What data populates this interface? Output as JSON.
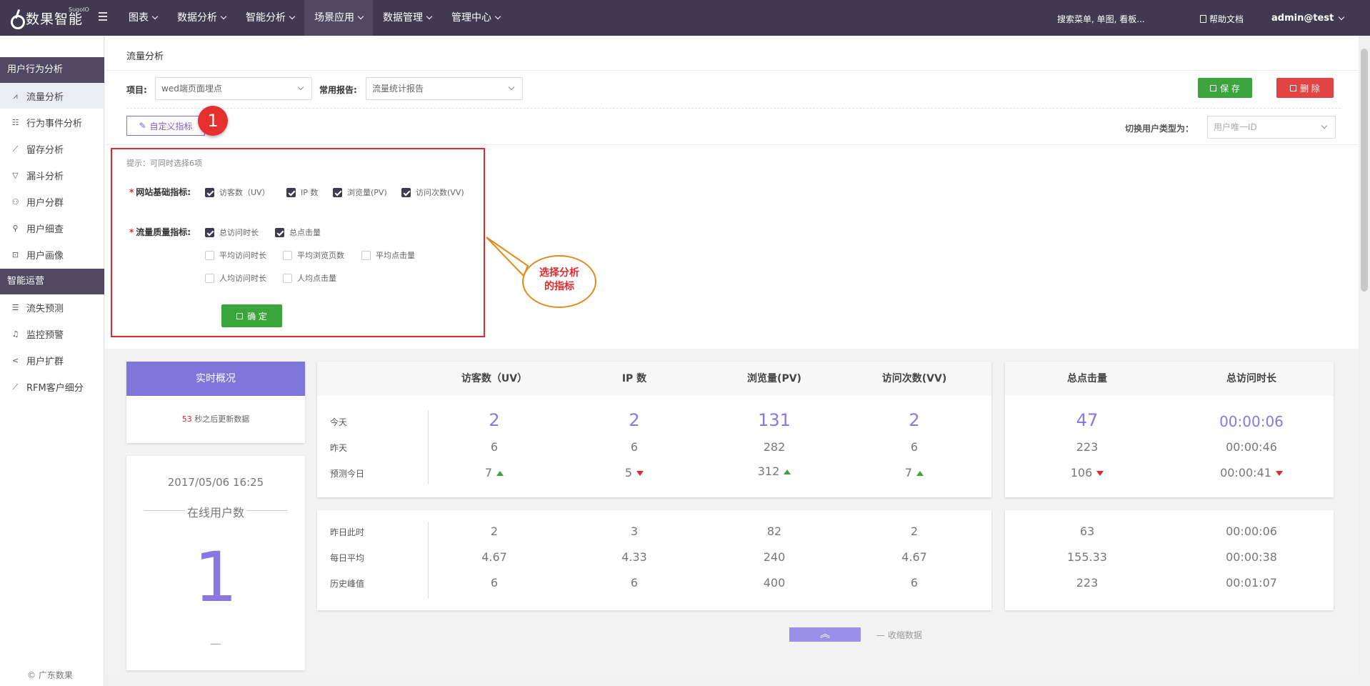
{
  "topbar": {
    "logo_text": "数果智能",
    "logo_sub": "SugoIO",
    "nav": [
      "图表",
      "数据分析",
      "智能分析",
      "场景应用",
      "数据管理",
      "管理中心"
    ],
    "search_text": "搜索菜单, 单图, 看板...",
    "help_text": "帮助文档",
    "user": "admin@test"
  },
  "sidebar": {
    "group1": "用户行为分析",
    "items1": [
      "流量分析",
      "行为事件分析",
      "留存分析",
      "漏斗分析",
      "用户分群",
      "用户细查",
      "用户画像"
    ],
    "group2": "智能运营",
    "items2": [
      "流失预测",
      "监控预警",
      "用户扩群",
      "RFM客户细分"
    ],
    "copyright": "© 广东数果"
  },
  "page": {
    "title": "流量分析",
    "project_label": "项目:",
    "project_value": "wed端页面埋点",
    "report_label": "常用报告:",
    "report_value": "流量统计报告",
    "save": "保 存",
    "delete": "删 除",
    "custom_metric": "自定义指标",
    "badge": "1",
    "switch_label": "切换用户类型为：",
    "switch_placeholder": "用户唯一ID"
  },
  "selector": {
    "hint": "提示：可同时选择6项",
    "basic_label": "网站基础指标:",
    "basic": [
      {
        "label": "访客数（UV）",
        "checked": true
      },
      {
        "label": "IP 数",
        "checked": true
      },
      {
        "label": "浏览量(PV)",
        "checked": true
      },
      {
        "label": "访问次数(VV)",
        "checked": true
      }
    ],
    "quality_label": "流量质量指标:",
    "quality": [
      {
        "label": "总访问时长",
        "checked": true
      },
      {
        "label": "总点击量",
        "checked": true
      },
      {
        "label": "平均访问时长",
        "checked": false
      },
      {
        "label": "平均浏览页数",
        "checked": false
      },
      {
        "label": "平均点击量",
        "checked": false
      },
      {
        "label": "人均访问时长",
        "checked": false
      },
      {
        "label": "人均点击量",
        "checked": false
      }
    ],
    "confirm": "确 定",
    "callout": "选择分析\n的指标"
  },
  "realtime": {
    "title": "实时概况",
    "countdown": "53",
    "countdown_suffix": "秒之后更新数据",
    "datetime": "2017/05/06 16:25",
    "online_label": "在线用户数",
    "online_count": "1",
    "dash": "—"
  },
  "table1": {
    "headers": [
      "访客数（UV）",
      "IP 数",
      "浏览量(PV)",
      "访问次数(VV)"
    ],
    "row_labels": [
      "今天",
      "昨天",
      "预测今日"
    ],
    "today": [
      "2",
      "2",
      "131",
      "2"
    ],
    "yesterday": [
      "6",
      "6",
      "282",
      "6"
    ],
    "forecast": [
      "7",
      "5",
      "312",
      "7"
    ],
    "forecast_trend": [
      "up",
      "down",
      "up",
      "up"
    ]
  },
  "table2": {
    "headers": [
      "总点击量",
      "总访问时长"
    ],
    "today": [
      "47",
      "00:00:06"
    ],
    "yesterday": [
      "223",
      "00:00:46"
    ],
    "forecast": [
      "106",
      "00:00:41"
    ],
    "forecast_trend": [
      "down",
      "down"
    ]
  },
  "table3": {
    "row_labels": [
      "昨日此时",
      "每日平均",
      "历史峰值"
    ],
    "rows": [
      [
        "2",
        "3",
        "82",
        "2"
      ],
      [
        "4.67",
        "4.33",
        "240",
        "4.67"
      ],
      [
        "6",
        "6",
        "400",
        "6"
      ]
    ]
  },
  "table4": {
    "rows": [
      [
        "63",
        "00:00:06"
      ],
      [
        "155.33",
        "00:00:38"
      ],
      [
        "223",
        "00:01:07"
      ]
    ]
  },
  "collapse": {
    "label": "— 收缩数据",
    "icon": "double-chevron-up-icon"
  },
  "colors": {
    "topbar": "#3f3a4f",
    "accent_purple": "#8a78e0",
    "realtime_header": "#7e76d8",
    "save_green": "#3aa53a",
    "delete_red": "#e24343",
    "highlight_red": "#e2282c",
    "callout_orange": "#e08a1e"
  }
}
